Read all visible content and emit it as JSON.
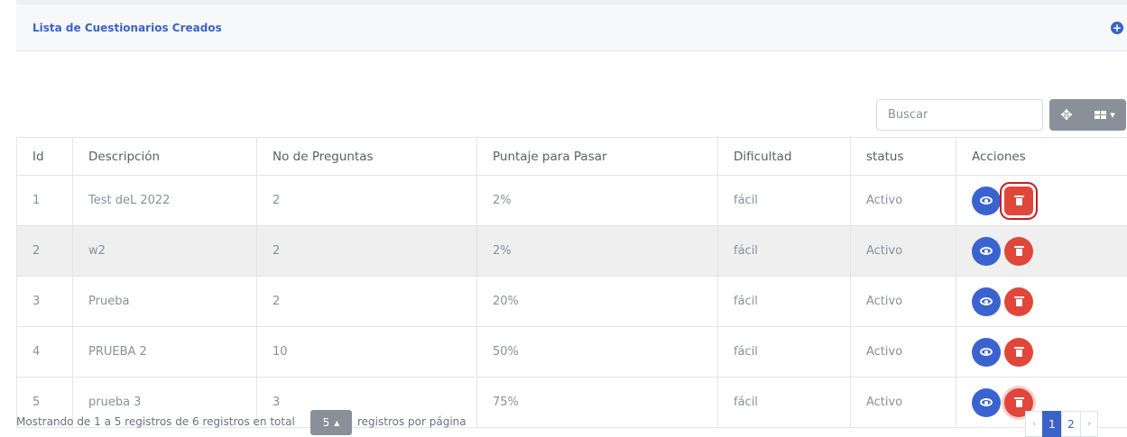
{
  "header": {
    "title": "Lista de Cuestionarios Creados",
    "add_icon": "plus-circle-icon"
  },
  "toolbar": {
    "search_placeholder": "Buscar",
    "move_icon": "arrows-move-icon",
    "columns_icon": "grid-columns-icon"
  },
  "table": {
    "columns": [
      "Id",
      "Descripción",
      "No de Preguntas",
      "Puntaje para Pasar",
      "Dificultad",
      "status",
      "Acciones"
    ],
    "rows": [
      {
        "id": "1",
        "descripcion": "Test deL 2022",
        "preguntas": "2",
        "puntaje": "2%",
        "dificultad": "fácil",
        "status": "Activo"
      },
      {
        "id": "2",
        "descripcion": "w2",
        "preguntas": "2",
        "puntaje": "2%",
        "dificultad": "fácil",
        "status": "Activo"
      },
      {
        "id": "3",
        "descripcion": "Prueba",
        "preguntas": "2",
        "puntaje": "20%",
        "dificultad": "fácil",
        "status": "Activo"
      },
      {
        "id": "4",
        "descripcion": "PRUEBA 2",
        "preguntas": "10",
        "puntaje": "50%",
        "dificultad": "fácil",
        "status": "Activo"
      },
      {
        "id": "5",
        "descripcion": "prueba 3",
        "preguntas": "3",
        "puntaje": "75%",
        "dificultad": "fácil",
        "status": "Activo"
      }
    ]
  },
  "footer": {
    "summary": "Mostrando de 1 a 5 registros de 6 registros en total",
    "page_size": "5",
    "per_page_label": "registros por página",
    "pages": [
      "1",
      "2"
    ],
    "prev": "‹",
    "next": "›"
  },
  "colors": {
    "primary": "#3b63c7",
    "danger": "#e1463b",
    "muted": "#8a9099"
  }
}
